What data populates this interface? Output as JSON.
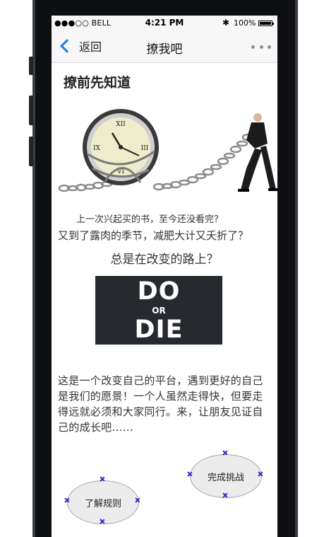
{
  "status_bar": {
    "carrier": "●●●○○ BELL",
    "time": "4:21 PM",
    "bluetooth": "✱",
    "battery_percent": "100%"
  },
  "nav": {
    "back_label": "返回",
    "title": "撩我吧",
    "more_icon": "more-dots-icon"
  },
  "content": {
    "heading": "撩前先知道",
    "line1": "上一次兴起买的书，至今还没看完？",
    "line2": "又到了露肉的季节，减肥大计又夭折了？",
    "line3": "总是在改变的路上？",
    "image_text": {
      "line1": "DO",
      "line2": "OR",
      "line3": "DIE"
    },
    "paragraph": "这是一个改变自己的平台，遇到更好的自己是我们的愿景！一个人虽然走得快，但要走得远就必须和大家同行。来，让朋友见证自己的成长吧......"
  },
  "buttons": {
    "finish_challenge": "完成挑战",
    "learn_rules": "了解规则"
  },
  "colors": {
    "accent": "#1e7ce6",
    "handle": "#2b2bcc",
    "image_bg": "#26292d"
  }
}
